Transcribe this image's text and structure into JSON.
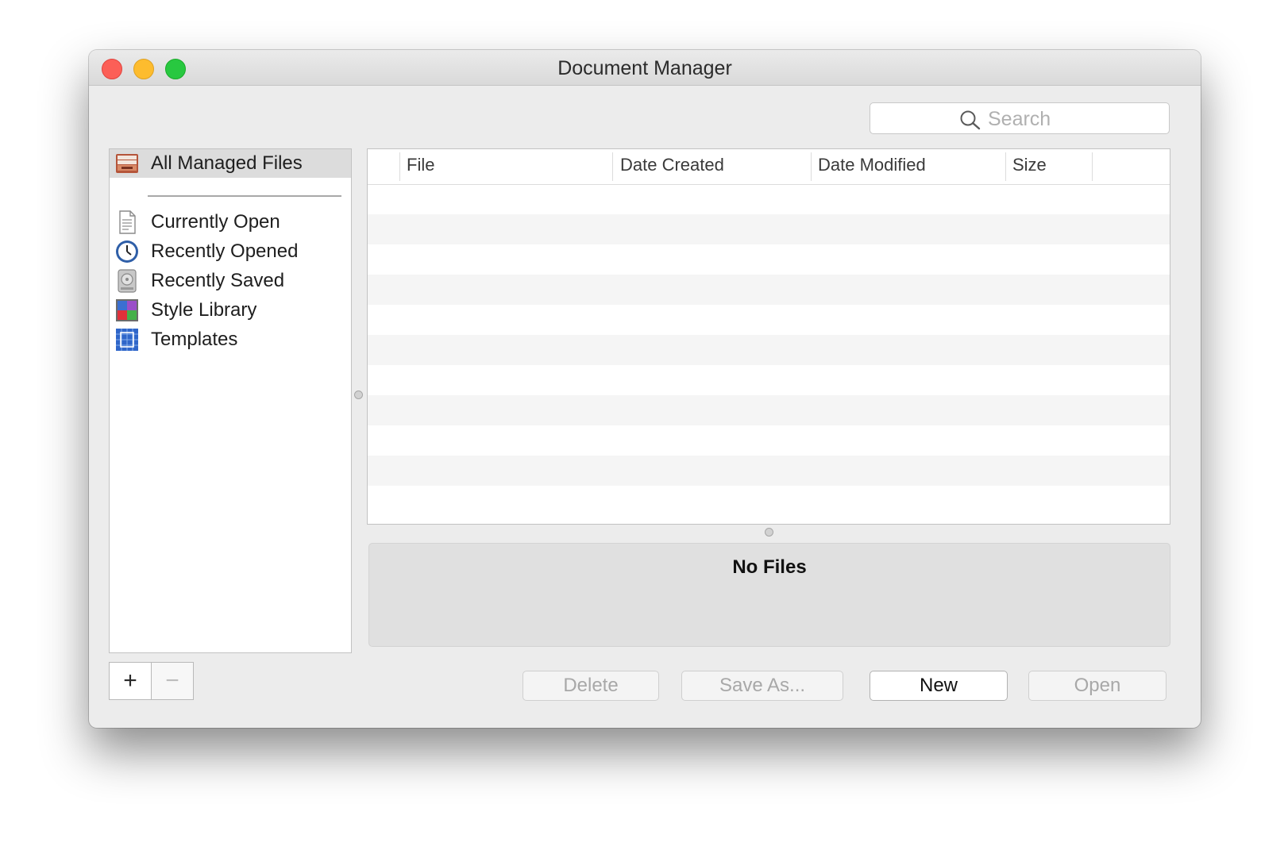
{
  "window": {
    "title": "Document Manager"
  },
  "search": {
    "placeholder": "Search",
    "value": ""
  },
  "sidebar": {
    "items": [
      {
        "label": "All Managed Files",
        "icon": "stack-of-files-icon",
        "selected": true
      },
      {
        "label": "Currently Open",
        "icon": "document-icon",
        "selected": false
      },
      {
        "label": "Recently Opened",
        "icon": "clock-icon",
        "selected": false
      },
      {
        "label": "Recently Saved",
        "icon": "hard-drive-icon",
        "selected": false
      },
      {
        "label": "Style Library",
        "icon": "color-palette-icon",
        "selected": false
      },
      {
        "label": "Templates",
        "icon": "blueprint-icon",
        "selected": false
      }
    ]
  },
  "table": {
    "columns": [
      "File",
      "Date Created",
      "Date Modified",
      "Size"
    ],
    "rows": []
  },
  "info": {
    "title": "No Files"
  },
  "footer": {
    "add_label": "+",
    "remove_label": "−",
    "buttons": {
      "delete": {
        "label": "Delete",
        "enabled": false
      },
      "save_as": {
        "label": "Save As...",
        "enabled": false
      },
      "new": {
        "label": "New",
        "enabled": true
      },
      "open": {
        "label": "Open",
        "enabled": false
      }
    }
  },
  "colors": {
    "close": "#fc5f57",
    "minimize": "#fdbc2e",
    "zoom": "#28c840",
    "selection": "#dcdcdc"
  }
}
